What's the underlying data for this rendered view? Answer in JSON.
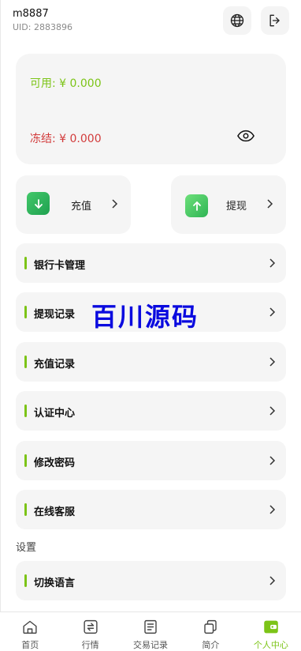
{
  "header": {
    "username": "m8887",
    "uid": "UID: 2883896"
  },
  "balance": {
    "available": "可用: ¥ 0.000",
    "frozen": "冻结: ¥ 0.000"
  },
  "actions": {
    "recharge": "充值",
    "withdraw": "提现"
  },
  "menu": [
    {
      "label": "银行卡管理"
    },
    {
      "label": "提现记录"
    },
    {
      "label": "充值记录"
    },
    {
      "label": "认证中心"
    },
    {
      "label": "修改密码"
    },
    {
      "label": "在线客服"
    }
  ],
  "settings": {
    "title": "设置",
    "items": [
      {
        "label": "切换语言"
      }
    ]
  },
  "watermark": "百川源码",
  "tabs": [
    {
      "label": "首页",
      "icon": "home-icon"
    },
    {
      "label": "行情",
      "icon": "exchange-icon"
    },
    {
      "label": "交易记录",
      "icon": "document-icon"
    },
    {
      "label": "简介",
      "icon": "copy-icon"
    },
    {
      "label": "个人中心",
      "icon": "wallet-icon"
    }
  ],
  "colors": {
    "accent": "#7cc417",
    "frozen": "#d23b3b",
    "card_bg": "#f5f5f5"
  }
}
